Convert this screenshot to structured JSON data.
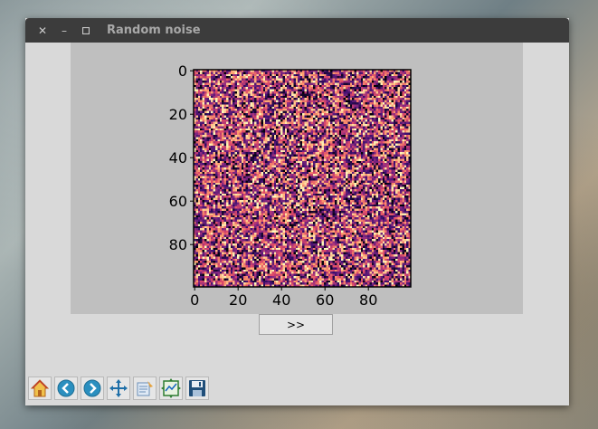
{
  "window": {
    "title": "Random noise"
  },
  "controls": {
    "next_label": ">>"
  },
  "toolbar": {
    "tools": [
      {
        "name": "home-icon"
      },
      {
        "name": "back-icon"
      },
      {
        "name": "forward-icon"
      },
      {
        "name": "pan-icon"
      },
      {
        "name": "zoom-icon"
      },
      {
        "name": "subplots-icon"
      },
      {
        "name": "save-icon"
      }
    ]
  },
  "chart_data": {
    "type": "heatmap",
    "title": "",
    "xlabel": "",
    "ylabel": "",
    "rows": 100,
    "cols": 100,
    "x_ticks": [
      "0",
      "20",
      "40",
      "60",
      "80"
    ],
    "y_ticks": [
      "0",
      "20",
      "40",
      "60",
      "80"
    ],
    "x_tick_values": [
      0,
      20,
      40,
      60,
      80
    ],
    "y_tick_values": [
      0,
      20,
      40,
      60,
      80
    ],
    "xlim": [
      -0.5,
      99.5
    ],
    "ylim": [
      99.5,
      -0.5
    ],
    "colormap": [
      "#000004",
      "#3b0f70",
      "#8c2981",
      "#de4968",
      "#fe9f6d",
      "#fcfdbf"
    ],
    "value_range": [
      0,
      1
    ]
  }
}
